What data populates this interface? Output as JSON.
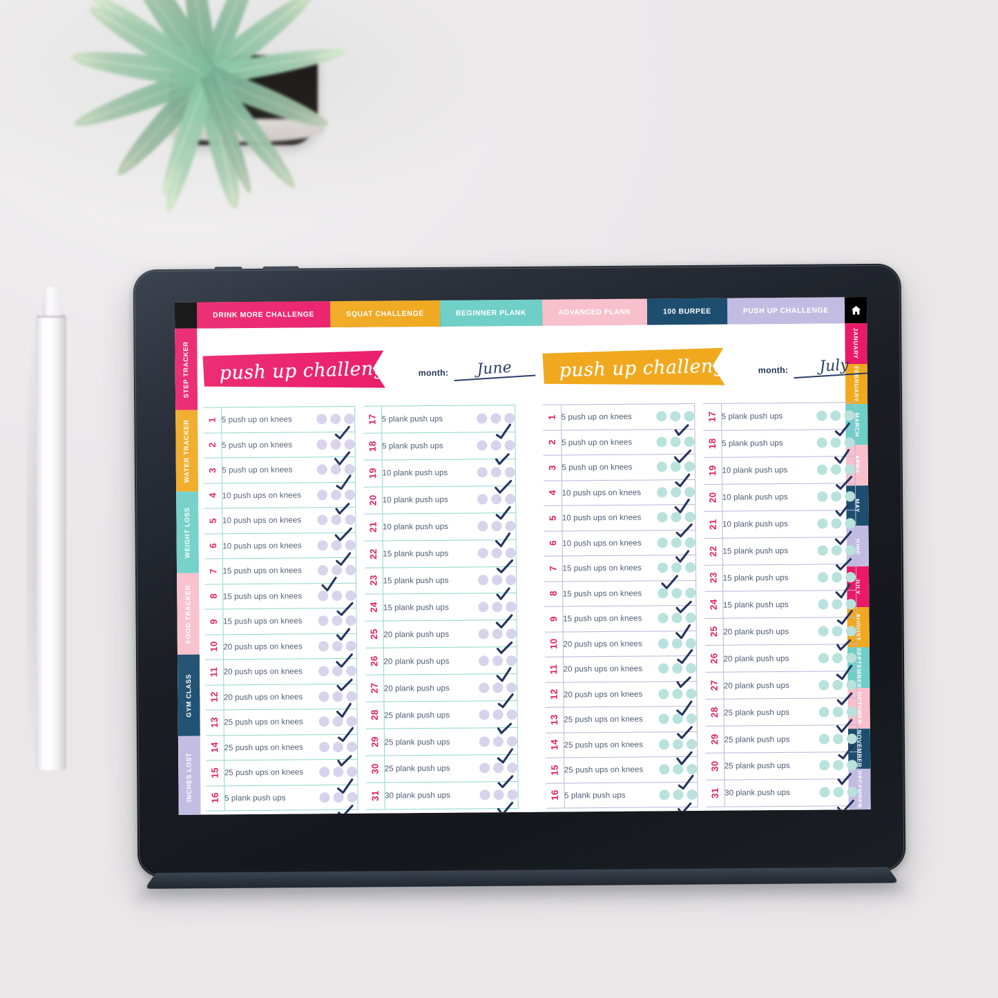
{
  "app": {
    "home_icon": "home-icon"
  },
  "top_tabs": [
    {
      "label": "DRINK MORE CHALLENGE",
      "color": "#ea1a66"
    },
    {
      "label": "SQUAT CHALLENGE",
      "color": "#f0a81e"
    },
    {
      "label": "BEGINNER PLANK",
      "color": "#6ecfc7"
    },
    {
      "label": "ADVANCED PLANK",
      "color": "#f8c0cc"
    },
    {
      "label": "100 BURPEE",
      "color": "#1d4e70"
    },
    {
      "label": "PUSH UP CHALLENGE",
      "color": "#c3bce2"
    }
  ],
  "left_tabs": [
    {
      "label": "STEP TRACKER",
      "color": "#ea1a66"
    },
    {
      "label": "WATER TRACKER",
      "color": "#f0a81e"
    },
    {
      "label": "WEIGHT LOSS",
      "color": "#6ecfc7"
    },
    {
      "label": "FOOD TRACKER",
      "color": "#f8c0cc"
    },
    {
      "label": "GYM CLASS",
      "color": "#1d4e70"
    },
    {
      "label": "INCHES LOST",
      "color": "#c3bce2"
    }
  ],
  "month_tabs": [
    {
      "label": "JANUARY",
      "color": "#ea1a66"
    },
    {
      "label": "FEBRUARY",
      "color": "#f0a81e"
    },
    {
      "label": "MARCH",
      "color": "#6ecfc7"
    },
    {
      "label": "APRIL",
      "color": "#f8c0cc"
    },
    {
      "label": "MAY",
      "color": "#1d4e70"
    },
    {
      "label": "JUNE",
      "color": "#c3bce2"
    },
    {
      "label": "JULY",
      "color": "#ea1a66"
    },
    {
      "label": "AUGUST",
      "color": "#f0a81e"
    },
    {
      "label": "SEPTEMBER",
      "color": "#6ecfc7"
    },
    {
      "label": "OCTOBER",
      "color": "#f8c0cc"
    },
    {
      "label": "NOVEMBER",
      "color": "#1d4e70"
    },
    {
      "label": "DECEMBER",
      "color": "#c3bce2"
    }
  ],
  "panels": [
    {
      "title": "push up challenge",
      "banner_color": "#ea1a66",
      "month_label": "month:",
      "month_value": "June",
      "grid_color": "#8ed4cd",
      "dot_color": "#d8d3ec",
      "column_a": [
        {
          "day": "1",
          "task": "5 push up on knees",
          "checked_index": 2
        },
        {
          "day": "2",
          "task": "5 push up on knees",
          "checked_index": 2
        },
        {
          "day": "3",
          "task": "5 push up on knees",
          "checked_index": 2
        },
        {
          "day": "4",
          "task": "10 push ups on knees",
          "checked_index": 2
        },
        {
          "day": "5",
          "task": "10 push ups on knees",
          "checked_index": 2
        },
        {
          "day": "6",
          "task": "10 push ups on knees",
          "checked_index": 2
        },
        {
          "day": "7",
          "task": "15 push ups on knees",
          "checked_index": 1
        },
        {
          "day": "8",
          "task": "15 push ups on knees",
          "checked_index": 2
        },
        {
          "day": "9",
          "task": "15 push ups on knees",
          "checked_index": 2
        },
        {
          "day": "10",
          "task": "20 push ups on knees",
          "checked_index": 2
        },
        {
          "day": "11",
          "task": "20 push ups on knees",
          "checked_index": 2
        },
        {
          "day": "12",
          "task": "20 push ups on knees",
          "checked_index": 2
        },
        {
          "day": "13",
          "task": "25 push ups on knees",
          "checked_index": 2
        },
        {
          "day": "14",
          "task": "25 push ups on knees",
          "checked_index": 2
        },
        {
          "day": "15",
          "task": "25 push ups on knees",
          "checked_index": 2
        },
        {
          "day": "16",
          "task": "5 plank push ups",
          "checked_index": 2
        }
      ],
      "column_b": [
        {
          "day": "17",
          "task": "5 plank push ups",
          "checked_index": 2
        },
        {
          "day": "18",
          "task": "5 plank push ups",
          "checked_index": 2
        },
        {
          "day": "19",
          "task": "10 plank push ups",
          "checked_index": 2
        },
        {
          "day": "20",
          "task": "10 plank push ups",
          "checked_index": 2
        },
        {
          "day": "21",
          "task": "10 plank push ups",
          "checked_index": 2
        },
        {
          "day": "22",
          "task": "15 plank push ups",
          "checked_index": 2
        },
        {
          "day": "23",
          "task": "15 plank push ups",
          "checked_index": 2
        },
        {
          "day": "24",
          "task": "15 plank push ups",
          "checked_index": 2
        },
        {
          "day": "25",
          "task": "20 plank push ups",
          "checked_index": 2
        },
        {
          "day": "26",
          "task": "20 plank push ups",
          "checked_index": 2
        },
        {
          "day": "27",
          "task": "20 plank push ups",
          "checked_index": 2
        },
        {
          "day": "28",
          "task": "25 plank push ups",
          "checked_index": 2
        },
        {
          "day": "29",
          "task": "25 plank push ups",
          "checked_index": 2
        },
        {
          "day": "30",
          "task": "25 plank push ups",
          "checked_index": 2
        },
        {
          "day": "31",
          "task": "30 plank push ups",
          "checked_index": 2
        }
      ]
    },
    {
      "title": "push up challenge",
      "banner_color": "#f0a81e",
      "month_label": "month:",
      "month_value": "July",
      "grid_color": "#b9b4d8",
      "dot_color": "#b9e2dd",
      "column_a": [
        {
          "day": "1",
          "task": "5 push up on knees",
          "checked_index": 2
        },
        {
          "day": "2",
          "task": "5 push up on knees",
          "checked_index": 2
        },
        {
          "day": "3",
          "task": "5 push up on knees",
          "checked_index": 2
        },
        {
          "day": "4",
          "task": "10 push ups on knees",
          "checked_index": 2
        },
        {
          "day": "5",
          "task": "10 push ups on knees",
          "checked_index": 2
        },
        {
          "day": "6",
          "task": "10 push ups on knees",
          "checked_index": 2
        },
        {
          "day": "7",
          "task": "15 push ups on knees",
          "checked_index": 1
        },
        {
          "day": "8",
          "task": "15 push ups on knees",
          "checked_index": 2
        },
        {
          "day": "9",
          "task": "15 push ups on knees",
          "checked_index": 2
        },
        {
          "day": "10",
          "task": "20 push ups on knees",
          "checked_index": 2
        },
        {
          "day": "11",
          "task": "20 push ups on knees",
          "checked_index": 2
        },
        {
          "day": "12",
          "task": "20 push ups on knees",
          "checked_index": 2
        },
        {
          "day": "13",
          "task": "25 push ups on knees",
          "checked_index": 2
        },
        {
          "day": "14",
          "task": "25 push ups on knees",
          "checked_index": 2
        },
        {
          "day": "15",
          "task": "25 push ups on knees",
          "checked_index": 2
        },
        {
          "day": "16",
          "task": "5 plank push ups",
          "checked_index": 2
        }
      ],
      "column_b": [
        {
          "day": "17",
          "task": "5 plank push ups",
          "checked_index": 2
        },
        {
          "day": "18",
          "task": "5 plank push ups",
          "checked_index": 2
        },
        {
          "day": "19",
          "task": "10 plank push ups",
          "checked_index": 2
        },
        {
          "day": "20",
          "task": "10 plank push ups",
          "checked_index": 2
        },
        {
          "day": "21",
          "task": "10 plank push ups",
          "checked_index": 2
        },
        {
          "day": "22",
          "task": "15 plank push ups",
          "checked_index": 2
        },
        {
          "day": "23",
          "task": "15 plank push ups",
          "checked_index": 2
        },
        {
          "day": "24",
          "task": "15 plank push ups",
          "checked_index": 2
        },
        {
          "day": "25",
          "task": "20 plank push ups",
          "checked_index": 2
        },
        {
          "day": "26",
          "task": "20 plank push ups",
          "checked_index": 2
        },
        {
          "day": "27",
          "task": "20 plank push ups",
          "checked_index": 2
        },
        {
          "day": "28",
          "task": "25 plank push ups",
          "checked_index": 2
        },
        {
          "day": "29",
          "task": "25 plank push ups",
          "checked_index": 2
        },
        {
          "day": "30",
          "task": "25 plank push ups",
          "checked_index": 2
        },
        {
          "day": "31",
          "task": "30 plank push ups",
          "checked_index": 2
        }
      ]
    }
  ]
}
